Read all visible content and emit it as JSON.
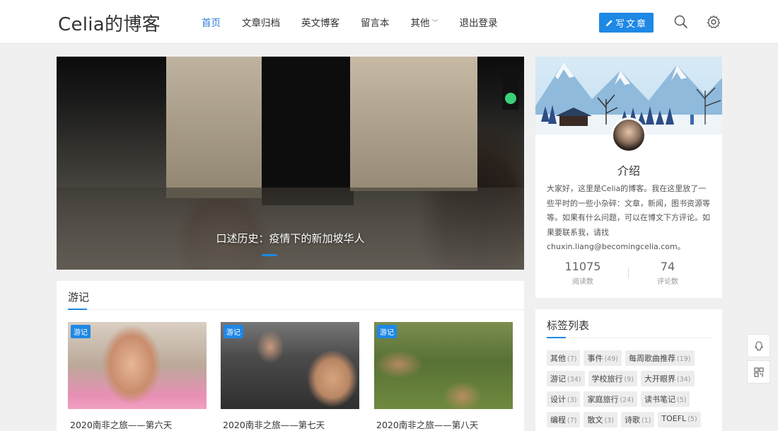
{
  "header": {
    "logo": "Celia的博客",
    "nav": [
      {
        "label": "首页"
      },
      {
        "label": "文章归档"
      },
      {
        "label": "英文博客"
      },
      {
        "label": "留言本"
      },
      {
        "label": "其他"
      },
      {
        "label": "退出登录"
      }
    ],
    "write_label": "写文章",
    "icons": [
      "search-icon",
      "gear-icon"
    ]
  },
  "hero": {
    "caption": "口述历史：疫情下的新加坡华人"
  },
  "travel": {
    "title": "游记",
    "posts": [
      {
        "tag": "游记",
        "title": "2020南非之旅——第六天"
      },
      {
        "tag": "游记",
        "title": "2020南非之旅——第七天"
      },
      {
        "tag": "游记",
        "title": "2020南非之旅——第八天"
      }
    ]
  },
  "profile": {
    "title": "介绍",
    "description": "大家好，这里是Celia的博客。我在这里放了一些平时的一些小杂碎：文章，新闻，图书资源等等。如果有什么问题，可以在博文下方评论。如果要联系我，请找 chuxin.liang@becomingcelia.com。",
    "reads": "11075",
    "reads_label": "阅读数",
    "comments": "74",
    "comments_label": "评论数"
  },
  "tags": {
    "title": "标签列表",
    "rows": [
      [
        {
          "name": "其他",
          "count": "(7)"
        },
        {
          "name": "事件",
          "count": "(49)"
        },
        {
          "name": "每周歌曲推荐",
          "count": "(19)"
        }
      ],
      [
        {
          "name": "游记",
          "count": "(34)"
        },
        {
          "name": "学校旅行",
          "count": "(9)"
        },
        {
          "name": "大开眼界",
          "count": "(34)"
        }
      ],
      [
        {
          "name": "设计",
          "count": "(3)"
        },
        {
          "name": "家庭旅行",
          "count": "(24)"
        },
        {
          "name": "读书笔记",
          "count": "(5)"
        }
      ],
      [
        {
          "name": "编程",
          "count": "(7)"
        },
        {
          "name": "散文",
          "count": "(3)"
        },
        {
          "name": "诗歌",
          "count": "(1)"
        },
        {
          "name": "TOEFL",
          "count": "(5)"
        }
      ]
    ]
  },
  "floating": [
    "qq-icon",
    "qrcode-icon"
  ],
  "colors": {
    "accent": "#1e88e5",
    "background": "#f0f0f0"
  }
}
